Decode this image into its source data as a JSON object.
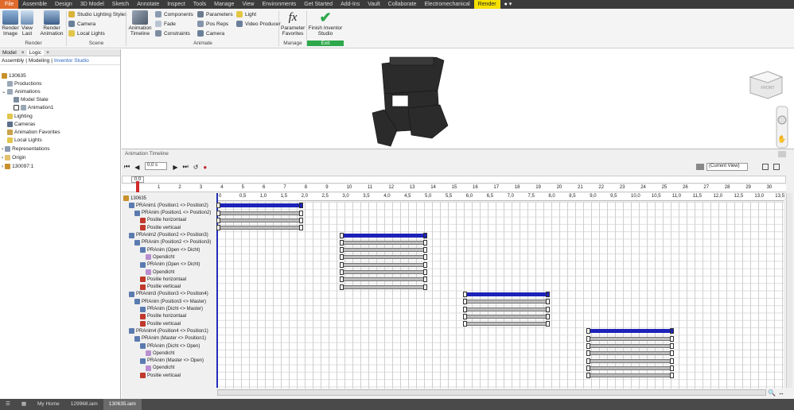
{
  "menubar": {
    "file": "File",
    "tabs": [
      "Assemble",
      "Design",
      "3D Model",
      "Sketch",
      "Annotate",
      "Inspect",
      "Tools",
      "Manage",
      "View",
      "Environments",
      "Get Started",
      "Add-Ins",
      "Vault",
      "Collaborate",
      "Electromechanical"
    ],
    "active": "Render"
  },
  "ribbon": {
    "render_image": "Render Image",
    "view_last": "View Last",
    "render_animation": "Render Animation",
    "studio_lighting": "Studio Lighting Styles",
    "camera": "Camera",
    "local_lights": "Local Lights",
    "render_group": "Render",
    "scene_group": "Scene",
    "animation_timeline": "Animation Timeline",
    "components": "Components",
    "fade": "Fade",
    "constraints": "Constraints",
    "parameters": "Parameters",
    "pos_reps": "Pos Reps",
    "camera2": "Camera",
    "light": "Light",
    "video_producer": "Video Producer",
    "animate_group": "Animate",
    "parameter_favorites": "Parameter Favorites",
    "manage_group": "Manage",
    "finish": "Finish Inventor Studio",
    "exit_group": "Exit"
  },
  "browser": {
    "tabs": [
      "Model",
      "Logic",
      "+"
    ],
    "subtabs": [
      "Assembly",
      "Modeling",
      "Inventor Studio"
    ],
    "items": [
      "130635",
      "Productions",
      "Animations",
      "Model State",
      "Animation1",
      "Lighting",
      "Cameras",
      "Animation Favorites",
      "Local Lights",
      "Representations",
      "Origin",
      "130097:1"
    ]
  },
  "timeline": {
    "title": "Animation Timeline",
    "time_value": "0,0 s",
    "view_select": "(Current View)",
    "scrub_value": "0,0",
    "top_ticks": [
      "1",
      "2",
      "3",
      "4",
      "5",
      "6",
      "7",
      "8",
      "9",
      "10",
      "11",
      "12",
      "13",
      "14",
      "15",
      "16",
      "17",
      "18",
      "19",
      "20",
      "21",
      "22",
      "23",
      "24",
      "25",
      "26",
      "27",
      "28",
      "29",
      "30"
    ],
    "ticks": [
      "0",
      "0,5",
      "1,0",
      "1,5",
      "2,0",
      "2,5",
      "3,0",
      "3,5",
      "4,0",
      "4,5",
      "5,0",
      "5,5",
      "6,0",
      "6,5",
      "7,0",
      "7,5",
      "8,0",
      "8,5",
      "9,0",
      "9,5",
      "10,0",
      "10,5",
      "11,0",
      "11,5",
      "12,0",
      "12,5",
      "13,0",
      "13,5"
    ],
    "root": "130635",
    "rows": [
      "PRAnim1 (Position1 <> Position2)",
      "PRAnim (Position1 <> Position2)",
      "Positie horizontaal",
      "Positie verticaal",
      "PRAnim2 (Position2 <> Position3)",
      "PRAnim (Position2 <> Position3)",
      "PRAnim (Open <> Dicht)",
      "Opendicht",
      "PRAnim (Open <> Dicht)",
      "Opendicht",
      "Positie horizontaal",
      "Positie verticaal",
      "PRAnim3 (Position3 <> Position4)",
      "PRAnim (Position3 <> Master)",
      "PRAnim (Dicht <> Master)",
      "Positie horizontaal",
      "Positie verticaal",
      "PRAnim4 (Position4 <> Position1)",
      "PRAnim (Master <> Position1)",
      "PRAnim (Dicht <> Open)",
      "Opendicht",
      "PRAnim (Master <> Open)",
      "Opendicht",
      "Positie verticaal"
    ]
  },
  "status_tabs": [
    "My Home",
    "129968.iam",
    "130635.iam"
  ],
  "colors": {
    "accent": "#1d22b8",
    "render_tab": "#f5e000",
    "file_tab": "#e06a2b",
    "finish_green": "#2da84a"
  }
}
